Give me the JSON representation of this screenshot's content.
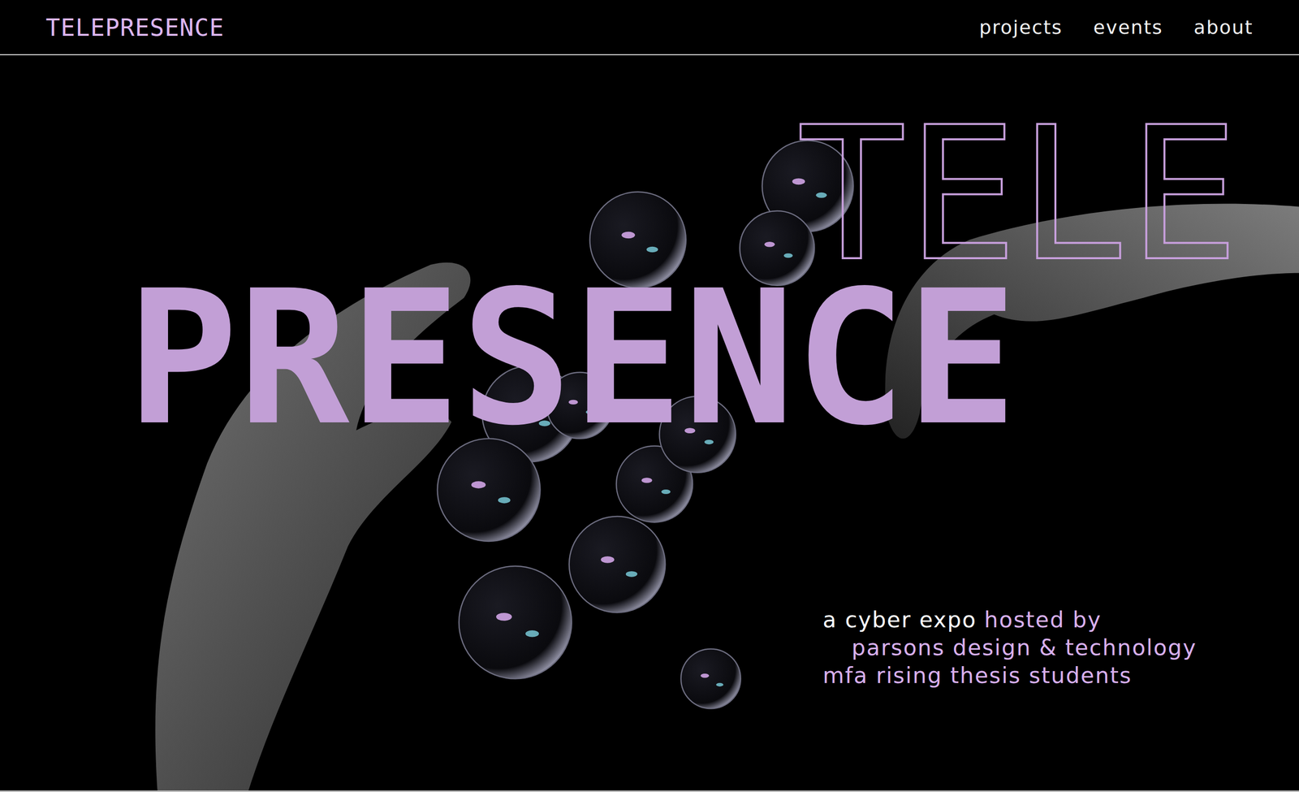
{
  "header": {
    "logo": "TELEPRESENCE",
    "nav": [
      {
        "label": "projects"
      },
      {
        "label": "events"
      },
      {
        "label": "about"
      }
    ]
  },
  "hero": {
    "title_top": "TELE",
    "title_bottom": "PRESENCE",
    "tagline": [
      [
        {
          "text": "a cyber expo",
          "color": "#ffffff"
        },
        {
          "text": "hosted by",
          "color": "#d8b0ee"
        }
      ],
      [
        {
          "text": "parsons design & technology",
          "color": "#d8b0ee"
        }
      ],
      [
        {
          "text": "mfa rising thesis students",
          "color": "#d8b0ee"
        }
      ]
    ]
  }
}
